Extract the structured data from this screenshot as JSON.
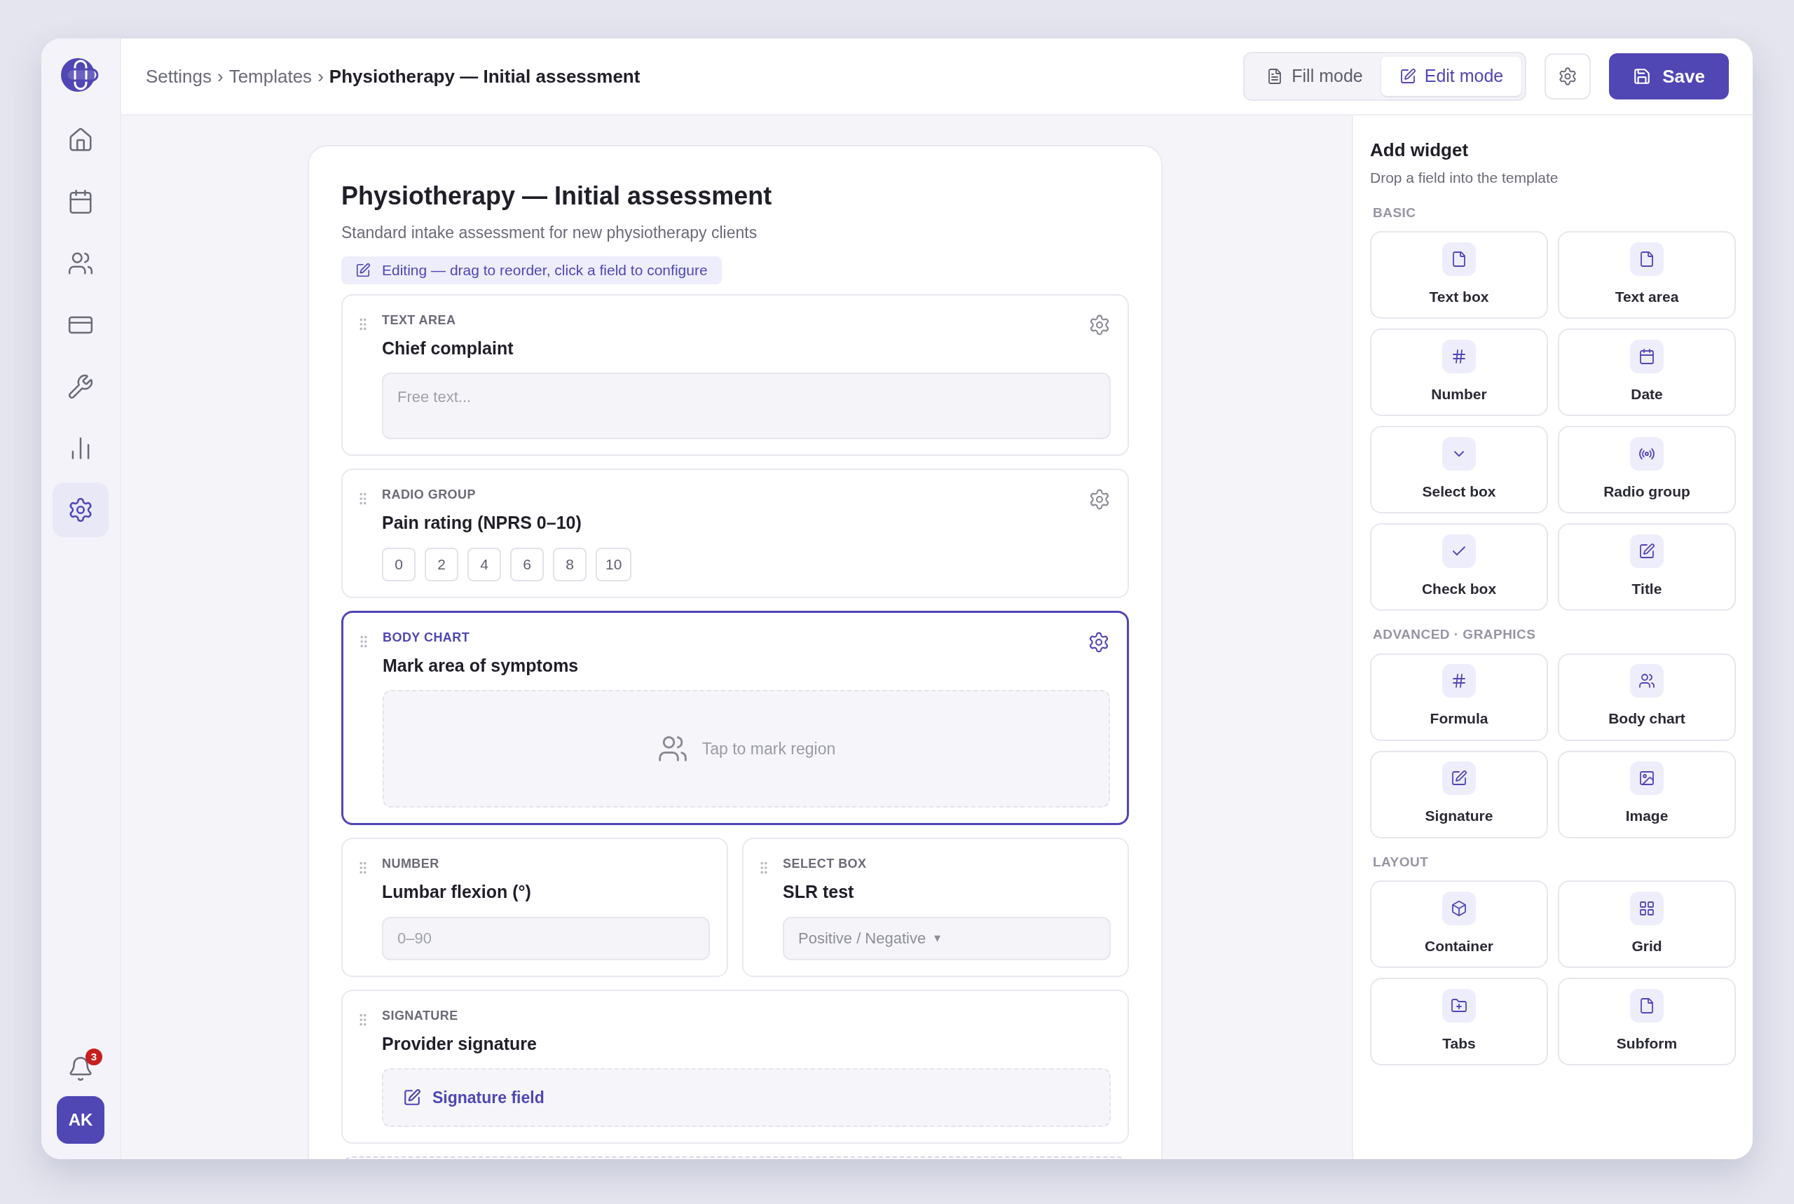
{
  "sidebar": {
    "items": [
      {
        "selected": false
      },
      {
        "selected": false
      },
      {
        "selected": false
      },
      {
        "selected": false
      },
      {
        "selected": false
      },
      {
        "selected": false
      },
      {
        "selected": true
      }
    ],
    "notifications": "3",
    "avatar": "AK"
  },
  "breadcrumb": [
    {
      "label": "Settings"
    },
    {
      "separator": "›",
      "label": "Templates"
    },
    {
      "separator": "›",
      "label": "Physiotherapy — Initial assessment"
    }
  ],
  "modes": [
    {
      "label": "Fill mode",
      "selected": false
    },
    {
      "label": "Edit mode",
      "selected": true
    }
  ],
  "save_button": "Save",
  "form": {
    "title": "Physiotherapy — Initial assessment",
    "subtitle": "Standard intake assessment for new physiotherapy clients",
    "edit_hint": "Editing — drag to reorder, click a field to configure",
    "field_rows": [
      {
        "fields": [
          {
            "kind": "textarea",
            "type_label": "TEXT AREA",
            "label": "Chief complaint",
            "placeholder": "Free text...",
            "selected": false
          }
        ]
      },
      {
        "fields": [
          {
            "kind": "radio",
            "type_label": "RADIO GROUP",
            "label": "Pain rating (NPRS 0–10)",
            "options": [
              {
                "label": "0",
                "selected": false
              },
              {
                "label": "2",
                "selected": false
              },
              {
                "label": "4",
                "selected": false
              },
              {
                "label": "6",
                "selected": false
              },
              {
                "label": "8",
                "selected": false
              },
              {
                "label": "10",
                "selected": false
              }
            ],
            "selected": false
          }
        ]
      },
      {
        "fields": [
          {
            "kind": "bodychart",
            "type_label": "BODY CHART",
            "label": "Mark area of symptoms",
            "prompt": "Tap to mark region",
            "selected": true
          }
        ]
      },
      {
        "fields": [
          {
            "kind": "number",
            "type_label": "NUMBER",
            "label": "Lumbar flexion (°)",
            "placeholder": "0–90",
            "selected": false
          },
          {
            "kind": "select",
            "type_label": "SELECT BOX",
            "label": "SLR test",
            "placeholder": "Positive / Negative",
            "caret": "▾",
            "selected": false
          }
        ]
      },
      {
        "fields": [
          {
            "kind": "signature",
            "type_label": "SIGNATURE",
            "label": "Provider signature",
            "prompt": "Signature field",
            "selected": false
          }
        ]
      }
    ]
  },
  "widget_panel": {
    "title": "Add widget",
    "subtitle": "Drop a field into the template",
    "sections": [
      {
        "heading": "BASIC",
        "widgets": [
          "Text box",
          "Text area",
          "Number",
          "Date",
          "Select box",
          "Radio group",
          "Check box",
          "Title"
        ]
      },
      {
        "heading": "ADVANCED · GRAPHICS",
        "widgets": [
          "Formula",
          "Body chart",
          "Signature",
          "Image"
        ]
      },
      {
        "heading": "LAYOUT",
        "widgets": [
          "Container",
          "Grid",
          "Tabs",
          "Subform"
        ]
      }
    ]
  }
}
